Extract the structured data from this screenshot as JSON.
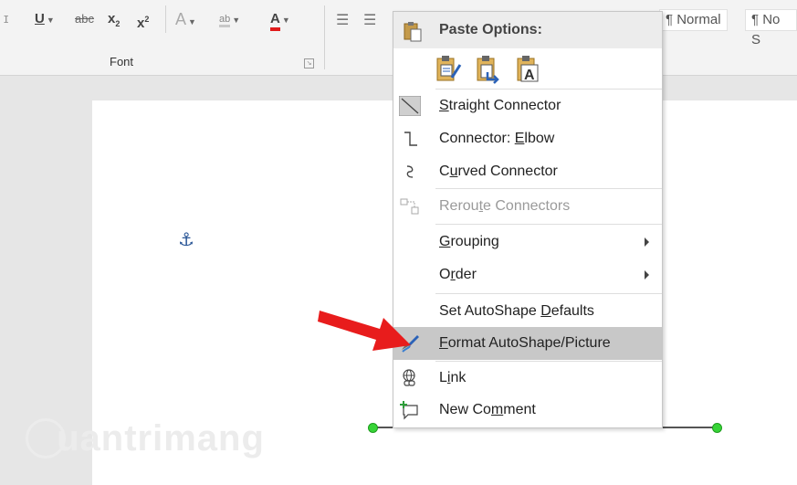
{
  "ribbon": {
    "underline": "U",
    "strikethrough": "abc",
    "subscript": "x",
    "subscript_mark": "2",
    "superscript": "x",
    "superscript_mark": "2",
    "text_effects": "A",
    "highlight": "ab",
    "font_color": "A",
    "font_color_value": "#e01b1b",
    "font_group_label": "Font",
    "styles": [
      "¶ Normal",
      "¶ No S"
    ]
  },
  "context_menu": {
    "paste_header": "Paste Options:",
    "paste_options": [
      "keep-source-formatting-icon",
      "merge-formatting-icon",
      "keep-text-only-icon"
    ],
    "items": [
      {
        "pre": "",
        "key": "S",
        "post": "traight Connector"
      },
      {
        "pre": "Connector: ",
        "key": "E",
        "post": "lbow"
      },
      {
        "pre": "C",
        "key": "u",
        "post": "rved Connector"
      },
      {
        "pre": "Rerou",
        "key": "t",
        "post": "e Connectors"
      },
      {
        "pre": "",
        "key": "G",
        "post": "rouping"
      },
      {
        "pre": "O",
        "key": "r",
        "post": "der"
      },
      {
        "pre": "Set AutoShape ",
        "key": "D",
        "post": "efaults"
      },
      {
        "pre": "",
        "key": "F",
        "post": "ormat AutoShape/Picture"
      },
      {
        "pre": "L",
        "key": "i",
        "post": "nk"
      },
      {
        "pre": "New Co",
        "key": "m",
        "post": "ment"
      }
    ]
  },
  "document": {
    "anchor": "⚓",
    "handle_color": "#37d437"
  },
  "watermark": "uantrimang",
  "accent": {
    "arrow": "#e81c1c",
    "highlight": "#c8c8c8"
  }
}
